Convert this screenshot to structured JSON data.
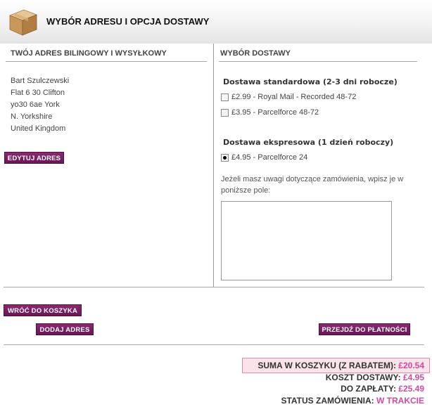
{
  "header": {
    "title": "WYBÓR ADRESU I OPCJA DOSTAWY"
  },
  "billing": {
    "heading": "TWÓJ ADRES BILINGOWY I WYSYŁKOWY",
    "lines": [
      "Bart Szulczewski",
      "Flat 6 30 Clifton",
      "yo30 6ae York",
      "N. Yorkshire",
      "United Kingdom"
    ],
    "edit_button": "EDYTUJ ADRES"
  },
  "delivery": {
    "heading": "WYBÓR DOSTAWY",
    "standard_title": "Dostawa standardowa (2-3 dni robocze)",
    "standard_options": [
      "£2.99 - Royal Mail - Recorded 48-72",
      "£3.95 - Parcelforce 48-72"
    ],
    "express_title": "Dostawa ekspresowa (1 dzień roboczy)",
    "express_options": [
      "£4.95 - Parcelforce 24"
    ],
    "selected": "£4.95 - Parcelforce 24",
    "note_label": "Jeżeli masz uwagi dotyczące zamówienia, wpisz je w poniższe pole:",
    "note_value": ""
  },
  "actions": {
    "back_button": "WRÓĆ DO KOSZYKA",
    "add_address_button": "DODAJ ADRES",
    "checkout_button": "PRZEJDŹ DO PŁATNOŚCI"
  },
  "totals": {
    "sum_label": "SUMA W KOSZYKU (Z RABATEM):",
    "sum_value": "£20.54",
    "shipping_label": "KOSZT DOSTAWY:",
    "shipping_value": "£4.95",
    "due_label": "DO ZAPŁATY:",
    "due_value": "£25.49",
    "status_label": "STATUS ZAMÓWIENIA:",
    "status_value": "W TRAKCIE"
  },
  "colors": {
    "button": "#6a1558",
    "accent_value": "#d04aa0",
    "highlight_bg": "#fbe3ea"
  },
  "icons": {
    "header": "cardboard-box-icon"
  }
}
